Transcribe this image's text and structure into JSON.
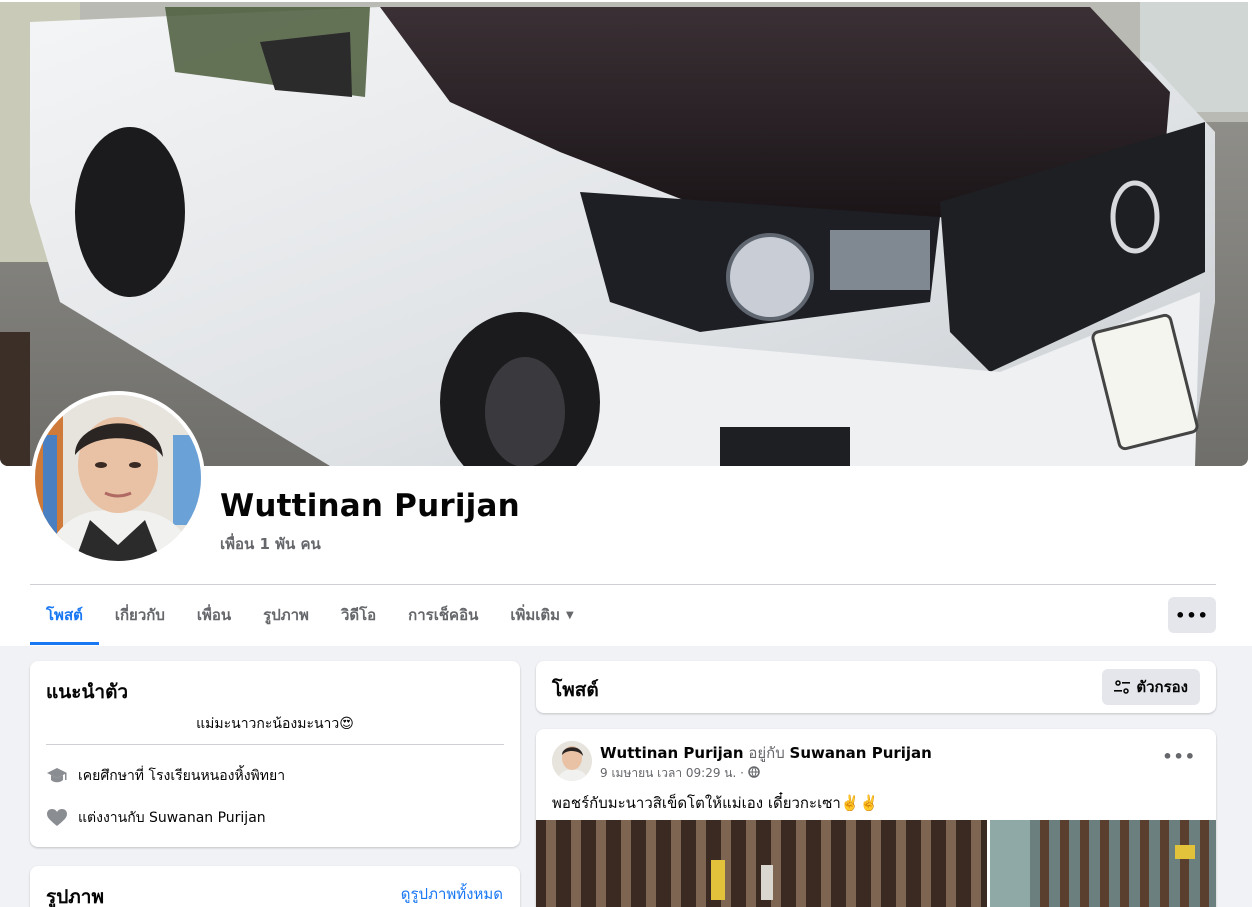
{
  "profile": {
    "name": "Wuttinan Purijan",
    "friends": "เพื่อน 1 พัน คน"
  },
  "tabs": [
    {
      "label": "โพสต์",
      "active": true
    },
    {
      "label": "เกี่ยวกับ",
      "active": false
    },
    {
      "label": "เพื่อน",
      "active": false
    },
    {
      "label": "รูปภาพ",
      "active": false
    },
    {
      "label": "วิดีโอ",
      "active": false
    },
    {
      "label": "การเช็คอิน",
      "active": false
    },
    {
      "label": "เพิ่มเติม",
      "active": false
    }
  ],
  "more_button": "•••",
  "intro": {
    "title": "แนะนำตัว",
    "bio": "แม่มะนาวกะน้องมะนาว😍",
    "education": "เคยศึกษาที่ โรงเรียนหนองหิ้งพิทยา",
    "relationship": "แต่งงานกับ Suwanan Purijan"
  },
  "photos": {
    "title": "รูปภาพ",
    "see_all": "ดูรูปภาพทั้งหมด"
  },
  "posts": {
    "title": "โพสต์",
    "filter_label": "ตัวกรอง"
  },
  "post": {
    "author": "Wuttinan Purijan",
    "with_text": "อยู่กับ",
    "tagged": "Suwanan Purijan",
    "meta": "9 เมษายน เวลา 09:29 น. ·",
    "text": "พอชร์กับมะนาวสิเข็ดโตให้แม่เอง เดี๋ยวกะเซา✌️✌️",
    "dots": "•••"
  },
  "colors": {
    "accent": "#1877f2",
    "secondary_text": "#65676b",
    "background": "#f0f2f5",
    "button_gray": "#e4e6eb"
  },
  "icons": [
    "graduation-cap-icon",
    "heart-icon",
    "filter-icon",
    "globe-icon",
    "caret-down-icon",
    "more-dots-icon"
  ]
}
